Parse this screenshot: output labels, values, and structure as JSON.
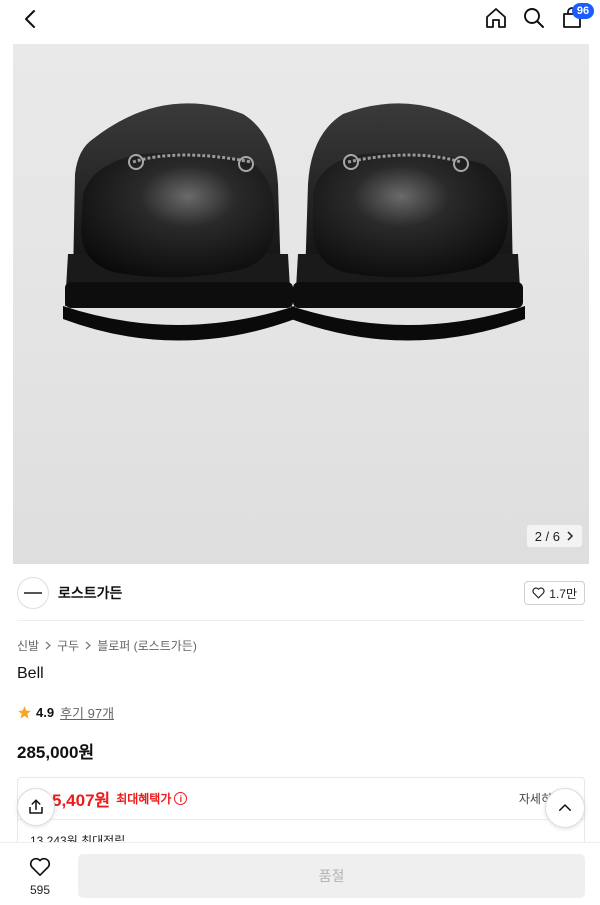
{
  "header": {
    "back_icon": "chevron-left-icon",
    "home_icon": "home-icon",
    "search_icon": "search-icon",
    "cart_icon": "cart-icon",
    "cart_count": "96"
  },
  "gallery": {
    "current": "2",
    "total": "6",
    "counter_text": "2 / 6"
  },
  "brand": {
    "name": "로스트가든",
    "like_count": "1.7만"
  },
  "breadcrumb": [
    "신발",
    "구두",
    "블로퍼 (로스트가든)"
  ],
  "product": {
    "title": "Bell",
    "rating": "4.9",
    "review_text": "후기 97개",
    "price": "285,000원"
  },
  "benefit": {
    "price_partial": "5,407원",
    "label": "최대혜택가",
    "detail_link": "자세히",
    "points_text": "13,243원 최대적립"
  },
  "bottom": {
    "wish_count": "595",
    "buy_label": "품절"
  },
  "colors": {
    "accent_red": "#ef1a1a",
    "badge_blue": "#1a5cff",
    "star": "#f5a623"
  }
}
